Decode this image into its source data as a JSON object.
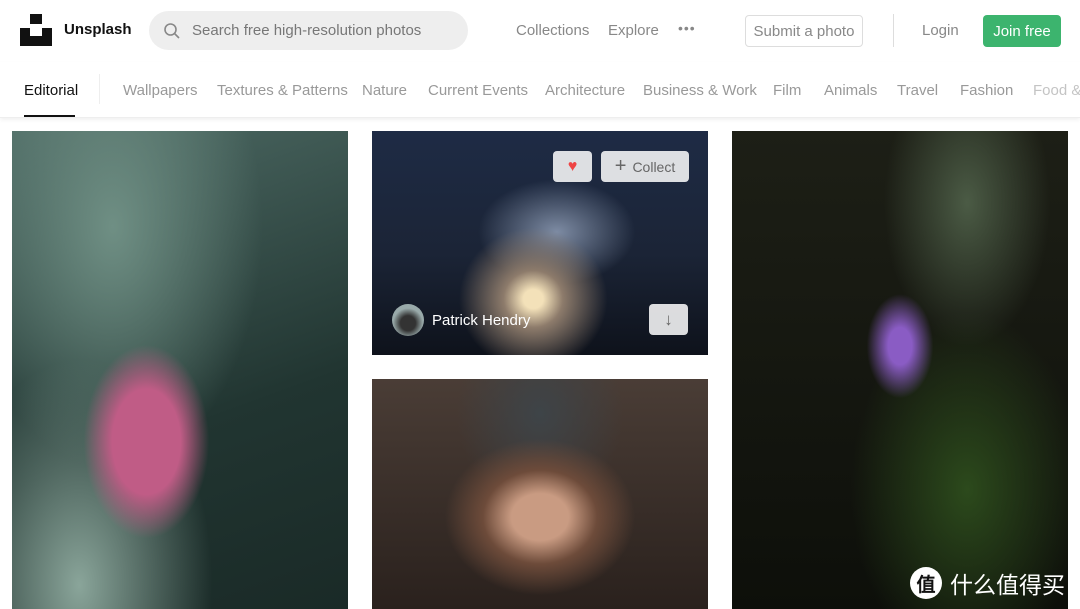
{
  "header": {
    "brand": "Unsplash",
    "search_placeholder": "Search free high-resolution photos",
    "nav": [
      "Collections",
      "Explore"
    ],
    "more": "•••",
    "submit": "Submit a photo",
    "login": "Login",
    "join": "Join free",
    "accent": "#3cb46e"
  },
  "categories": {
    "active": "Editorial",
    "items": [
      "Wallpapers",
      "Textures & Patterns",
      "Nature",
      "Current Events",
      "Architecture",
      "Business & Work",
      "Film",
      "Animals",
      "Travel",
      "Fashion",
      "Food &"
    ]
  },
  "photos": {
    "hovered": {
      "collect": "Collect",
      "author": "Patrick Hendry"
    }
  },
  "watermark": {
    "logo_char": "值",
    "text": "什么值得买"
  }
}
